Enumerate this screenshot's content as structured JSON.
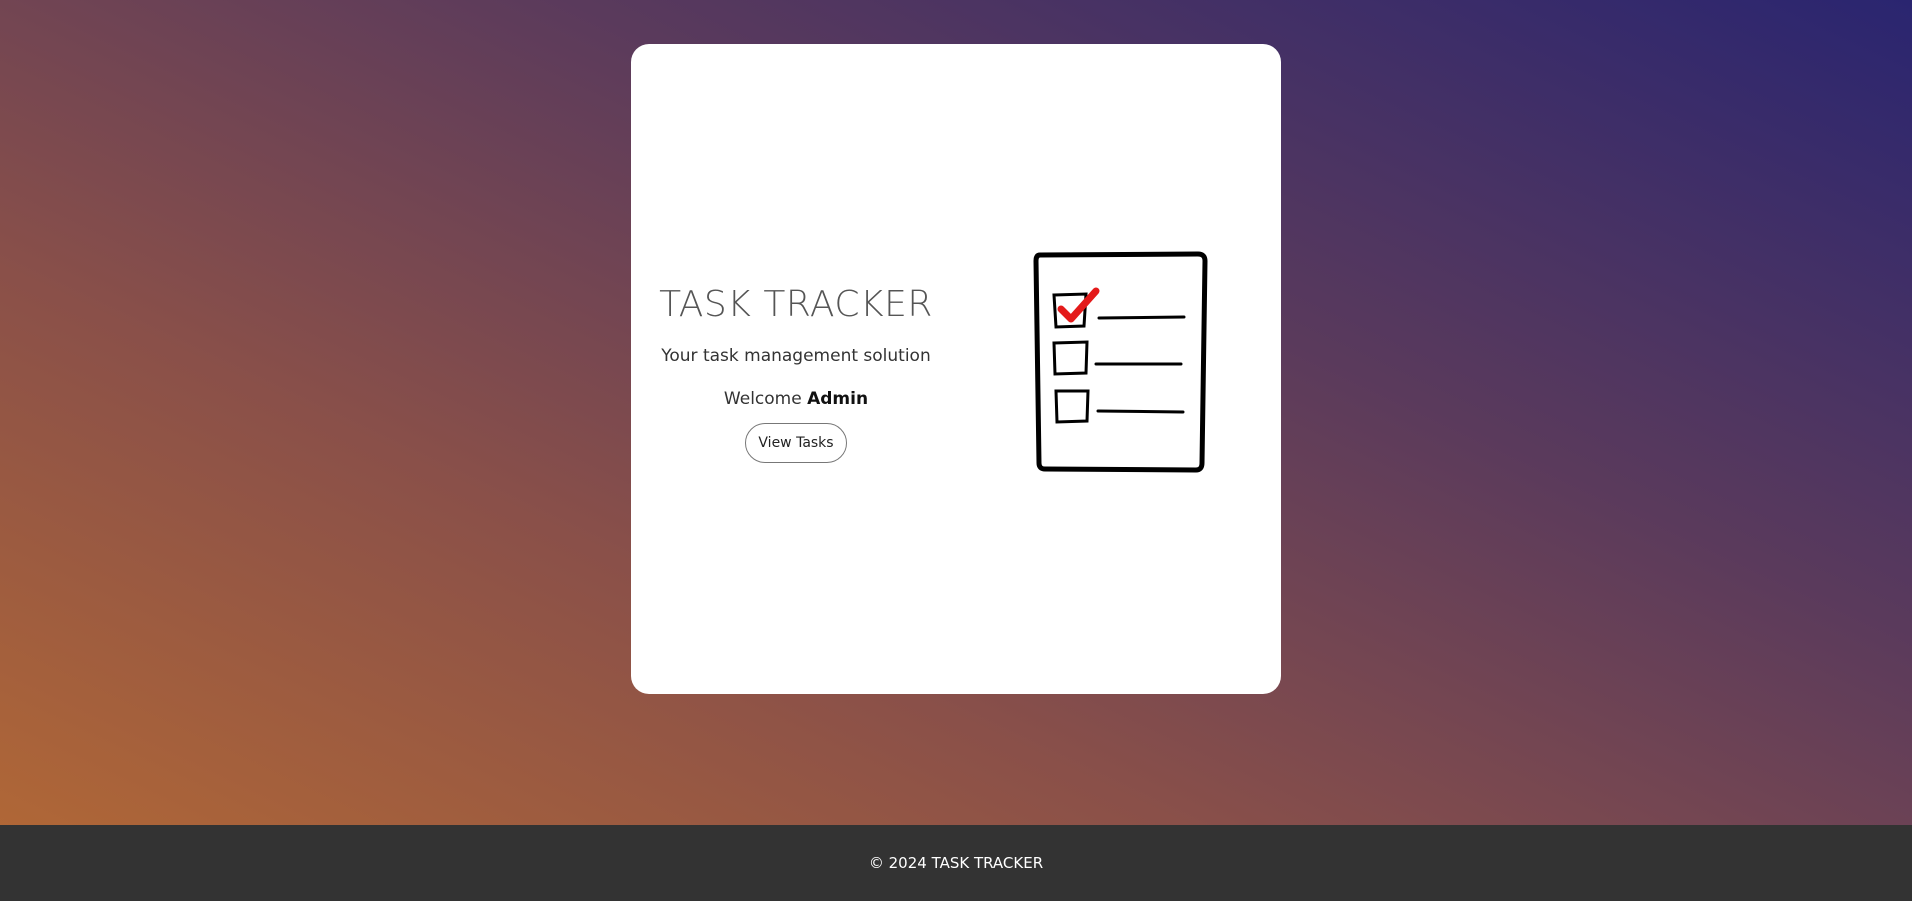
{
  "card": {
    "title": "TASK TRACKER",
    "subtitle": "Your task management solution",
    "welcome_prefix": "Welcome",
    "welcome_user": "Admin",
    "view_tasks_label": "View Tasks",
    "illustration_icon": "checklist-clipboard-icon"
  },
  "footer": {
    "copyright": "© 2024 TASK TRACKER"
  },
  "colors": {
    "gradient_start": "#b56a34",
    "gradient_end": "#2a2570",
    "card_bg": "#ffffff",
    "footer_bg": "#333333",
    "checkmark": "#e41a1a"
  }
}
